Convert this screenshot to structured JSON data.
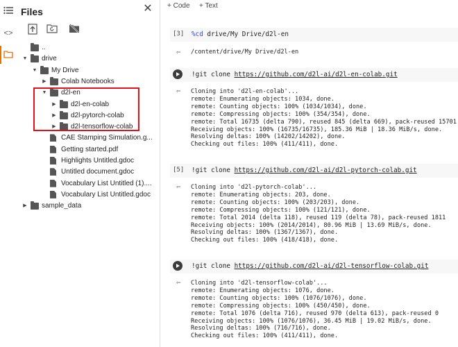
{
  "files_panel": {
    "title": "Files",
    "tree": [
      {
        "label": "..",
        "kind": "up",
        "depth": 0,
        "arrow": "none"
      },
      {
        "label": "drive",
        "kind": "folder",
        "depth": 0,
        "arrow": "open"
      },
      {
        "label": "My Drive",
        "kind": "folder",
        "depth": 1,
        "arrow": "open"
      },
      {
        "label": "Colab Notebooks",
        "kind": "folder",
        "depth": 2,
        "arrow": "closed"
      },
      {
        "label": "d2l-en",
        "kind": "folder",
        "depth": 2,
        "arrow": "open"
      },
      {
        "label": "d2l-en-colab",
        "kind": "folder",
        "depth": 3,
        "arrow": "closed"
      },
      {
        "label": "d2l-pytorch-colab",
        "kind": "folder",
        "depth": 3,
        "arrow": "closed"
      },
      {
        "label": "d2l-tensorflow-colab",
        "kind": "folder",
        "depth": 3,
        "arrow": "closed"
      },
      {
        "label": "CAE Stamping Simulation.g...",
        "kind": "file",
        "depth": 2,
        "arrow": "none"
      },
      {
        "label": "Getting started.pdf",
        "kind": "file",
        "depth": 2,
        "arrow": "none"
      },
      {
        "label": "Highlights Untitled.gdoc",
        "kind": "file",
        "depth": 2,
        "arrow": "none"
      },
      {
        "label": "Untitled document.gdoc",
        "kind": "file",
        "depth": 2,
        "arrow": "none"
      },
      {
        "label": "Vocabulary List Untitled (1)....",
        "kind": "file",
        "depth": 2,
        "arrow": "none"
      },
      {
        "label": "Vocabulary List Untitled.gdoc",
        "kind": "file",
        "depth": 2,
        "arrow": "none"
      },
      {
        "label": "sample_data",
        "kind": "folder",
        "depth": 0,
        "arrow": "closed"
      }
    ]
  },
  "toolbar": {
    "add_code": "+ Code",
    "add_text": "+ Text"
  },
  "cells": [
    {
      "exec_count": "[3]",
      "magic": "%cd",
      "code_rest": " drive/My Drive/d2l-en",
      "url": "",
      "output": "/content/drive/My Drive/d2l-en"
    },
    {
      "exec_count": "",
      "magic": "",
      "code_rest": "!git clone ",
      "url": "https://github.com/d2l-ai/d2l-en-colab.git",
      "output": "Cloning into 'd2l-en-colab'...\nremote: Enumerating objects: 1034, done.\nremote: Counting objects: 100% (1034/1034), done.\nremote: Compressing objects: 100% (354/354), done.\nremote: Total 16735 (delta 790), reused 845 (delta 669), pack-reused 15701\nReceiving objects: 100% (16735/16735), 185.36 MiB | 18.36 MiB/s, done.\nResolving deltas: 100% (14202/14202), done.\nChecking out files: 100% (411/411), done."
    },
    {
      "exec_count": "[5]",
      "magic": "",
      "code_rest": "!git clone ",
      "url": "https://github.com/d2l-ai/d2l-pytorch-colab.git",
      "output": "Cloning into 'd2l-pytorch-colab'...\nremote: Enumerating objects: 203, done.\nremote: Counting objects: 100% (203/203), done.\nremote: Compressing objects: 100% (121/121), done.\nremote: Total 2014 (delta 118), reused 119 (delta 78), pack-reused 1811\nReceiving objects: 100% (2014/2014), 80.96 MiB | 13.69 MiB/s, done.\nResolving deltas: 100% (1367/1367), done.\nChecking out files: 100% (418/418), done."
    },
    {
      "exec_count": "",
      "magic": "",
      "code_rest": "!git clone ",
      "url": "https://github.com/d2l-ai/d2l-tensorflow-colab.git",
      "output": "Cloning into 'd2l-tensorflow-colab'...\nremote: Enumerating objects: 1076, done.\nremote: Counting objects: 100% (1076/1076), done.\nremote: Compressing objects: 100% (450/450), done.\nremote: Total 1076 (delta 716), reused 970 (delta 613), pack-reused 0\nReceiving objects: 100% (1076/1076), 36.45 MiB | 19.02 MiB/s, done.\nResolving deltas: 100% (716/716), done.\nChecking out files: 100% (411/411), done."
    }
  ],
  "colors": {
    "highlight": "#e4111b",
    "active_rail": "#e37400",
    "magic": "#3b48cc"
  }
}
